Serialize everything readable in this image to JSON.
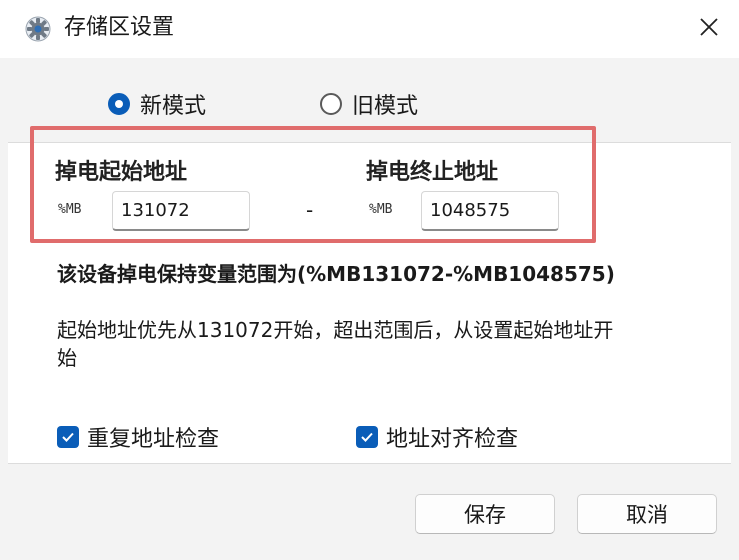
{
  "window": {
    "title": "存储区设置",
    "title_icon": "gear-icon",
    "close_icon": "close-icon"
  },
  "mode": {
    "new_label": "新模式",
    "old_label": "旧模式",
    "selected": "新模式"
  },
  "start": {
    "label": "掉电起始地址",
    "prefix": "%MB",
    "value": "131072"
  },
  "separator": "-",
  "end": {
    "label": "掉电终止地址",
    "prefix": "%MB",
    "value": "1048575"
  },
  "range_text": "该设备掉电保持变量范围为(%MB131072-%MB1048575)",
  "note_text": "起始地址优先从131072开始，超出范围后，从设置起始地址开始",
  "checks": {
    "duplicate_label": "重复地址检查",
    "duplicate_checked": true,
    "align_label": "地址对齐检查",
    "align_checked": true
  },
  "buttons": {
    "save_label": "保存",
    "cancel_label": "取消"
  },
  "colors": {
    "accent": "#0a5db8",
    "highlight_border": "#e06c6c"
  }
}
